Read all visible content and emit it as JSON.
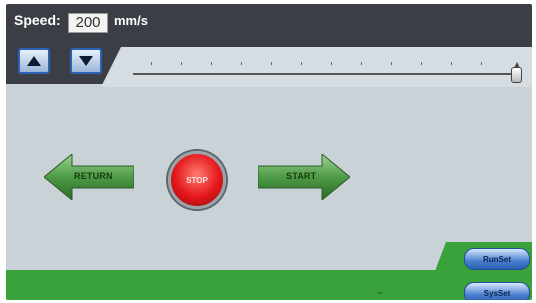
{
  "header": {
    "speed_label": "Speed:",
    "speed_value": "200",
    "speed_unit": "mm/s"
  },
  "controls": {
    "return_label": "RETURN",
    "stop_label": "STOP",
    "start_label": "START"
  },
  "settings": {
    "runset_label": "RunSet",
    "sysset_label": "SysSet"
  },
  "slider": {
    "position_fraction": 1.0
  },
  "colors": {
    "top_bar": "#3b3f45",
    "screen_bg": "#c9d2d7",
    "arrow_green": "#3f8b3a",
    "stop_red": "#e5171b",
    "bottom_green": "#3aa23a",
    "button_blue": "#2a62b8"
  },
  "icons": {
    "up": "up-triangle-icon",
    "down": "down-triangle-icon",
    "return": "left-arrow-icon",
    "start": "right-arrow-icon"
  }
}
